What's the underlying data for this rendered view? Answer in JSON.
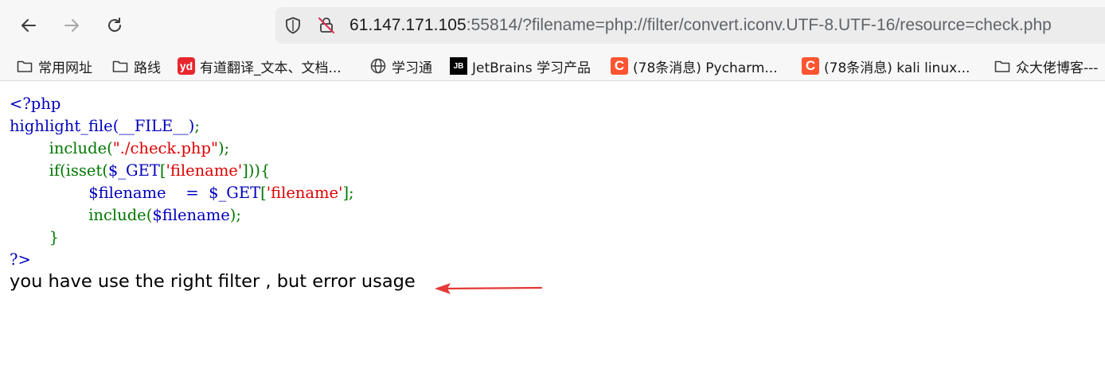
{
  "browser": {
    "url_host": "61.147.171.105",
    "url_rest": ":55814/?filename=php://filter/convert.iconv.UTF-8.UTF-16/resource=check.php"
  },
  "bookmarks": [
    {
      "label": "常用网址",
      "icon": "folder-icon"
    },
    {
      "label": "路线",
      "icon": "folder-icon"
    },
    {
      "label": "有道翻译_文本、文档...",
      "icon": "youdao-icon",
      "icon_text": "yd"
    },
    {
      "label": "学习通",
      "icon": "globe-icon"
    },
    {
      "label": "JetBrains 学习产品",
      "icon": "jetbrains-icon",
      "icon_text": "JB"
    },
    {
      "label": "(78条消息) Pycharm...",
      "icon": "csdn-icon",
      "icon_text": "C"
    },
    {
      "label": "(78条消息) kali linux...",
      "icon": "csdn-icon",
      "icon_text": "C"
    },
    {
      "label": "众大佬博客---",
      "icon": "folder-icon"
    }
  ],
  "code": {
    "open_tag": "<?php",
    "line1_func": "highlight_file(__FILE__)",
    "line1_end": ";",
    "line2_func": "include(",
    "line2_str": "\"./check.php\"",
    "line2_end": ");",
    "line3_a": "if(isset(",
    "line3_var": "$_GET",
    "line3_b": "[",
    "line3_str": "'filename'",
    "line3_c": "])){",
    "line4_var": "$filename    =  $_GET",
    "line4_b": "[",
    "line4_str": "'filename'",
    "line4_c": "];",
    "line5_a": "include(",
    "line5_var": "$filename",
    "line5_b": ");",
    "line6": "}",
    "close_tag": "?>"
  },
  "message": "you have use the right filter , but error usage",
  "colors": {
    "php_default": "#0000bb",
    "php_keyword": "#007700",
    "php_string": "#dd0000",
    "arrow": "#e53935"
  }
}
